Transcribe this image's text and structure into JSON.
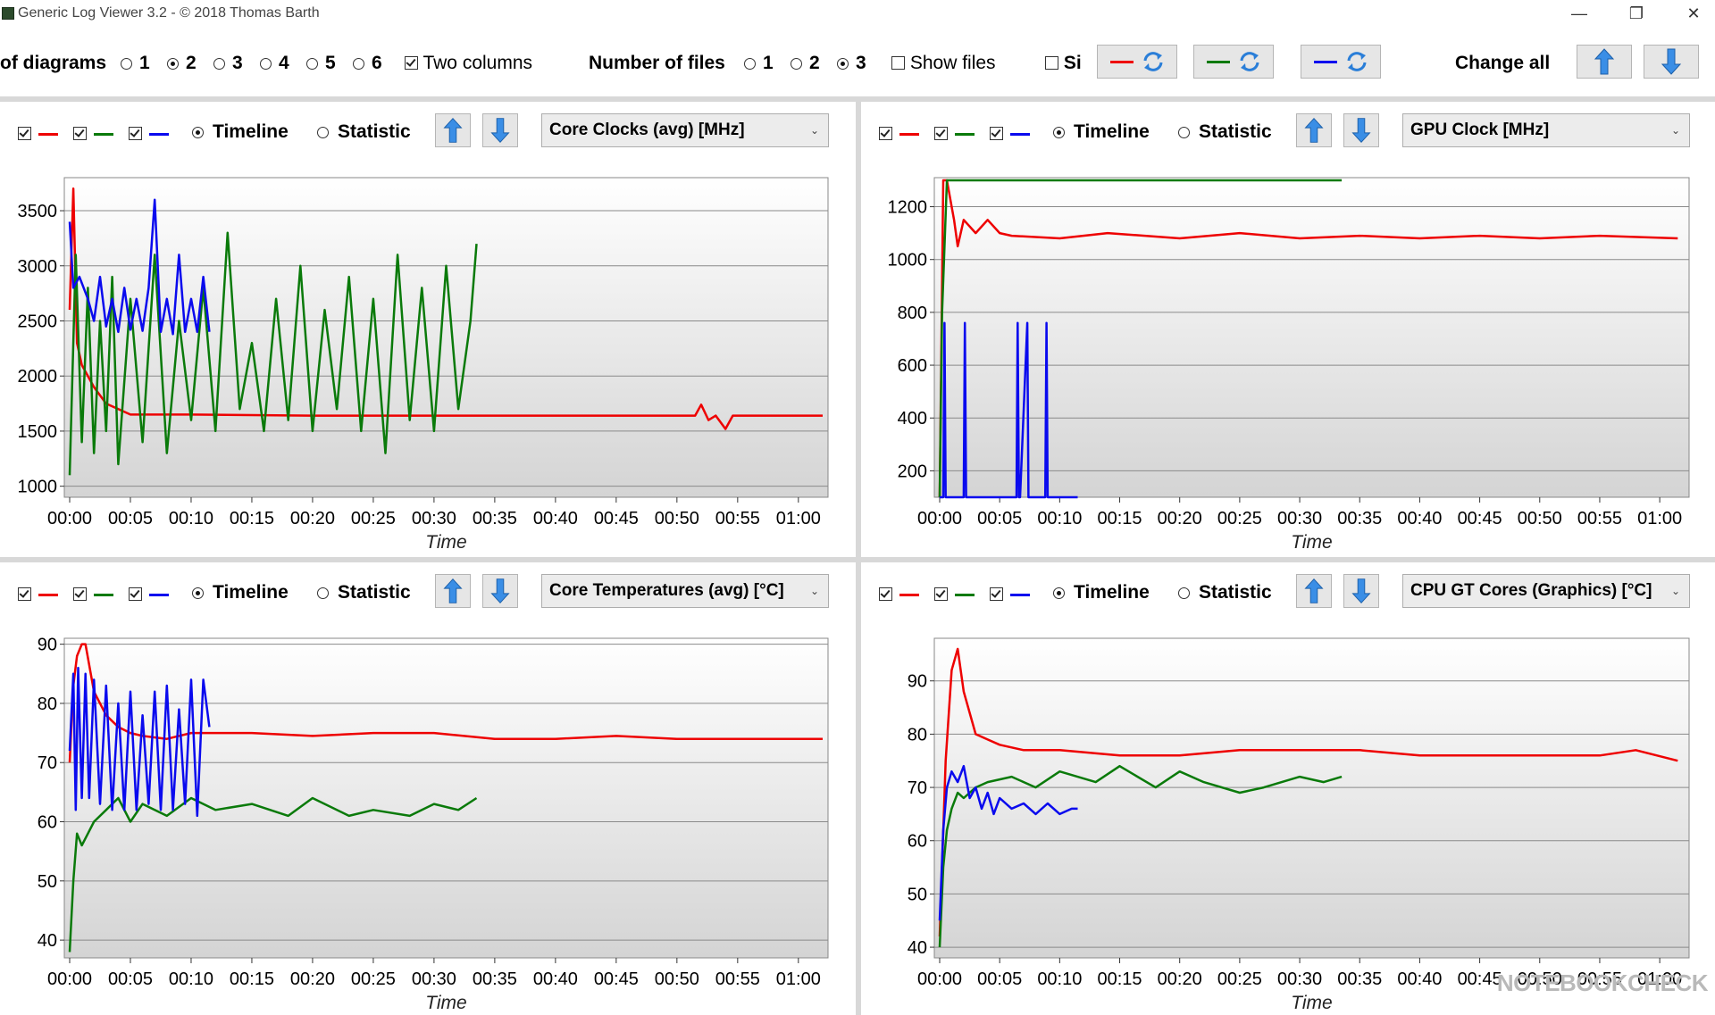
{
  "window": {
    "title": "Generic Log Viewer 3.2 - © 2018 Thomas Barth",
    "minimize_glyph": "—",
    "maximize_glyph": "❐",
    "close_glyph": "✕"
  },
  "toolbar": {
    "diagrams_label": "of diagrams",
    "diagram_options": [
      "1",
      "2",
      "3",
      "4",
      "5",
      "6"
    ],
    "diagram_selected": "2",
    "two_columns_label": "Two columns",
    "two_columns_checked": true,
    "files_label": "Number of files",
    "file_options": [
      "1",
      "2",
      "3"
    ],
    "file_selected": "3",
    "show_files_label": "Show files",
    "show_files_checked": false,
    "si_label": "Si",
    "change_all_label": "Change all"
  },
  "colors": {
    "red": "#ee0000",
    "green": "#0a7a0a",
    "blue": "#0a0aee",
    "arrow": "#3a8ee6"
  },
  "panels": [
    {
      "timeline_label": "Timeline",
      "statistic_label": "Statistic",
      "mode": "Timeline",
      "sensor": "Core Clocks (avg) [MHz]",
      "chart_data": {
        "type": "line",
        "xlabel": "Time",
        "x_ticks": [
          "00:00",
          "00:05",
          "00:10",
          "00:15",
          "00:20",
          "00:25",
          "00:30",
          "00:35",
          "00:40",
          "00:45",
          "00:50",
          "00:55",
          "01:00"
        ],
        "xlim": [
          0,
          62
        ],
        "ylim": [
          900,
          3800
        ],
        "y_ticks": [
          1000,
          1500,
          2000,
          2500,
          3000,
          3500
        ],
        "series": [
          {
            "color": "#ee0000",
            "x": [
              0,
              0.3,
              0.6,
              1,
              2,
              3,
              5,
              10,
              20,
              30,
              35,
              40,
              45,
              51.5,
              52,
              52.6,
              53.2,
              54,
              54.6,
              55,
              62
            ],
            "y": [
              2600,
              3700,
              2300,
              2100,
              1900,
              1750,
              1650,
              1650,
              1640,
              1640,
              1640,
              1640,
              1640,
              1640,
              1740,
              1600,
              1640,
              1520,
              1640,
              1640,
              1640
            ]
          },
          {
            "color": "#0a7a0a",
            "x": [
              0,
              0.5,
              1,
              1.5,
              2,
              2.5,
              3,
              3.5,
              4,
              5,
              6,
              7,
              8,
              9,
              10,
              11,
              12,
              13,
              14,
              15,
              16,
              17,
              18,
              19,
              20,
              21,
              22,
              23,
              24,
              25,
              26,
              27,
              28,
              29,
              30,
              31,
              32,
              33,
              33.5
            ],
            "y": [
              1100,
              3100,
              1400,
              2800,
              1300,
              2500,
              1500,
              2900,
              1200,
              2700,
              1400,
              3100,
              1300,
              2500,
              1600,
              2800,
              1500,
              3300,
              1700,
              2300,
              1500,
              2700,
              1600,
              3000,
              1500,
              2600,
              1700,
              2900,
              1500,
              2700,
              1300,
              3100,
              1600,
              2800,
              1500,
              3000,
              1700,
              2500,
              3200
            ]
          },
          {
            "color": "#0a0aee",
            "x": [
              0,
              0.3,
              0.8,
              1.5,
              2,
              2.5,
              3,
              3.5,
              4,
              4.5,
              5,
              5.5,
              6,
              6.5,
              7,
              7.5,
              8,
              8.5,
              9,
              9.5,
              10,
              10.5,
              11,
              11.5
            ],
            "y": [
              3400,
              2800,
              2900,
              2700,
              2500,
              2900,
              2450,
              2700,
              2400,
              2800,
              2420,
              2700,
              2410,
              2800,
              3600,
              2400,
              2700,
              2380,
              3100,
              2400,
              2700,
              2400,
              2900,
              2400
            ]
          }
        ]
      }
    },
    {
      "timeline_label": "Timeline",
      "statistic_label": "Statistic",
      "mode": "Timeline",
      "sensor": "GPU Clock [MHz]",
      "chart_data": {
        "type": "line",
        "xlabel": "Time",
        "x_ticks": [
          "00:00",
          "00:05",
          "00:10",
          "00:15",
          "00:20",
          "00:25",
          "00:30",
          "00:35",
          "00:40",
          "00:45",
          "00:50",
          "00:55",
          "01:00"
        ],
        "xlim": [
          0,
          62
        ],
        "ylim": [
          100,
          1310
        ],
        "y_ticks": [
          200,
          400,
          600,
          800,
          1000,
          1200
        ],
        "series": [
          {
            "color": "#ee0000",
            "x": [
              0,
              0.3,
              0.6,
              1,
              1.2,
              1.5,
              2,
              3,
              4,
              5,
              6,
              10,
              14,
              20,
              25,
              30,
              35,
              40,
              45,
              50,
              55,
              61.5
            ],
            "y": [
              100,
              1300,
              1300,
              1200,
              1150,
              1050,
              1150,
              1100,
              1150,
              1100,
              1090,
              1080,
              1100,
              1080,
              1100,
              1080,
              1090,
              1080,
              1090,
              1080,
              1090,
              1080
            ]
          },
          {
            "color": "#0a7a0a",
            "x": [
              0,
              0.2,
              0.6,
              1,
              5,
              10,
              20,
              30,
              33.5
            ],
            "y": [
              100,
              800,
              1300,
              1300,
              1300,
              1300,
              1300,
              1300,
              1300
            ]
          },
          {
            "color": "#0a0aee",
            "x": [
              0,
              0.3,
              0.4,
              0.5,
              2,
              2.1,
              2.2,
              6.4,
              6.5,
              6.6,
              6.7,
              7.3,
              7.4,
              7.5,
              8.8,
              8.9,
              9,
              11.5
            ],
            "y": [
              100,
              100,
              760,
              100,
              100,
              760,
              100,
              100,
              760,
              100,
              100,
              760,
              100,
              100,
              100,
              760,
              100,
              100
            ]
          }
        ]
      }
    },
    {
      "timeline_label": "Timeline",
      "statistic_label": "Statistic",
      "mode": "Timeline",
      "sensor": "Core Temperatures (avg) [°C]",
      "chart_data": {
        "type": "line",
        "xlabel": "Time",
        "x_ticks": [
          "00:00",
          "00:05",
          "00:10",
          "00:15",
          "00:20",
          "00:25",
          "00:30",
          "00:35",
          "00:40",
          "00:45",
          "00:50",
          "00:55",
          "01:00"
        ],
        "xlim": [
          0,
          62
        ],
        "ylim": [
          37,
          91
        ],
        "y_ticks": [
          40,
          50,
          60,
          70,
          80,
          90
        ],
        "series": [
          {
            "color": "#ee0000",
            "x": [
              0,
              0.3,
              0.6,
              1,
              1.3,
              2,
              3,
              4,
              5,
              6,
              8,
              10,
              12,
              15,
              20,
              25,
              30,
              35,
              40,
              45,
              50,
              55,
              62
            ],
            "y": [
              70,
              83,
              88,
              90,
              90,
              82,
              78,
              76,
              75,
              74.5,
              74,
              75,
              75,
              75,
              74.5,
              75,
              75,
              74,
              74,
              74.5,
              74,
              74,
              74
            ]
          },
          {
            "color": "#0a7a0a",
            "x": [
              0,
              0.3,
              0.6,
              1,
              1.5,
              2,
              3,
              4,
              5,
              6,
              7,
              8,
              10,
              12,
              15,
              18,
              20,
              23,
              25,
              28,
              30,
              32,
              33.5
            ],
            "y": [
              38,
              50,
              58,
              56,
              58,
              60,
              62,
              64,
              60,
              63,
              62,
              61,
              64,
              62,
              63,
              61,
              64,
              61,
              62,
              61,
              63,
              62,
              64
            ]
          },
          {
            "color": "#0a0aee",
            "x": [
              0,
              0.3,
              0.5,
              0.7,
              1,
              1.3,
              1.6,
              2,
              2.5,
              3,
              3.5,
              4,
              4.5,
              5,
              5.5,
              6,
              6.5,
              7,
              7.5,
              8,
              8.5,
              9,
              9.5,
              10,
              10.5,
              11,
              11.5
            ],
            "y": [
              72,
              85,
              62,
              86,
              64,
              85,
              64,
              84,
              63,
              83,
              62,
              80,
              62,
              82,
              62,
              78,
              63,
              82,
              62,
              83,
              62,
              79,
              63,
              84,
              61,
              84,
              76
            ]
          }
        ]
      }
    },
    {
      "timeline_label": "Timeline",
      "statistic_label": "Statistic",
      "mode": "Timeline",
      "sensor": "CPU GT Cores (Graphics) [°C]",
      "chart_data": {
        "type": "line",
        "xlabel": "Time",
        "x_ticks": [
          "00:00",
          "00:05",
          "00:10",
          "00:15",
          "00:20",
          "00:25",
          "00:30",
          "00:35",
          "00:40",
          "00:45",
          "00:50",
          "00:55",
          "01:00"
        ],
        "xlim": [
          0,
          62
        ],
        "ylim": [
          38,
          98
        ],
        "y_ticks": [
          40,
          50,
          60,
          70,
          80,
          90
        ],
        "series": [
          {
            "color": "#ee0000",
            "x": [
              0,
              0.5,
              1,
              1.5,
              2,
              3,
              4,
              5,
              7,
              10,
              15,
              20,
              25,
              30,
              35,
              40,
              45,
              50,
              55,
              58,
              61.5
            ],
            "y": [
              42,
              75,
              92,
              96,
              88,
              80,
              79,
              78,
              77,
              77,
              76,
              76,
              77,
              77,
              77,
              76,
              76,
              76,
              76,
              77,
              75
            ]
          },
          {
            "color": "#0a7a0a",
            "x": [
              0,
              0.3,
              0.6,
              1,
              1.5,
              2,
              3,
              4,
              6,
              8,
              10,
              13,
              15,
              18,
              20,
              22,
              25,
              27,
              30,
              32,
              33.5
            ],
            "y": [
              40,
              55,
              62,
              66,
              69,
              68,
              70,
              71,
              72,
              70,
              73,
              71,
              74,
              70,
              73,
              71,
              69,
              70,
              72,
              71,
              72
            ]
          },
          {
            "color": "#0a0aee",
            "x": [
              0,
              0.3,
              0.6,
              1,
              1.5,
              2,
              2.5,
              3,
              3.5,
              4,
              4.5,
              5,
              6,
              7,
              8,
              9,
              10,
              11,
              11.5
            ],
            "y": [
              45,
              62,
              70,
              73,
              71,
              74,
              68,
              70,
              66,
              69,
              65,
              68,
              66,
              67,
              65,
              67,
              65,
              66,
              66
            ]
          }
        ]
      }
    }
  ],
  "watermark": "NOTEBOOKCHECK"
}
